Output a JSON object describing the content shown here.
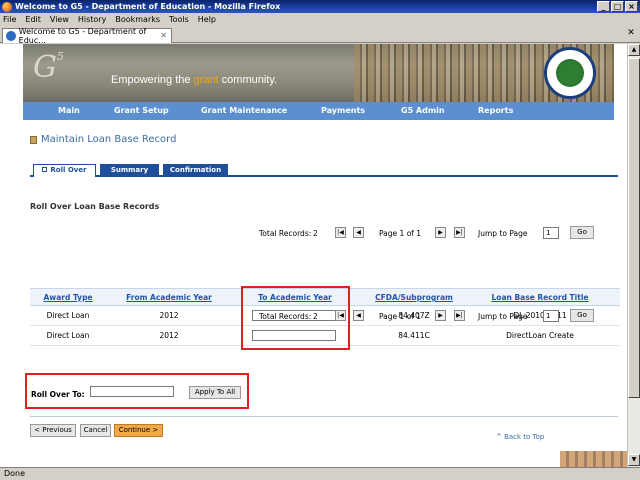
{
  "window": {
    "title": "Welcome to G5 - Department of Education - Mozilla Firefox"
  },
  "menu": [
    "File",
    "Edit",
    "View",
    "History",
    "Bookmarks",
    "Tools",
    "Help"
  ],
  "browser_tab": {
    "label": "Welcome to G5 - Department of Educ..."
  },
  "banner": {
    "logo_sup": "5",
    "tagline_pre": "Empowering the ",
    "tagline_grant": "grant",
    "tagline_post": " community."
  },
  "nav": [
    "Main",
    "Grant Setup",
    "Grant Maintenance",
    "Payments",
    "G5 Admin",
    "Reports"
  ],
  "page_title": "Maintain Loan Base Record",
  "tabs": [
    "Roll Over",
    "Summary",
    "Confirmation"
  ],
  "section_title": "Roll Over Loan Base Records",
  "pager": {
    "total_label": "Total Records:",
    "total": "2",
    "page_info": "Page 1 of 1",
    "jump_label": "Jump to Page",
    "jump_value": "1",
    "go": "Go"
  },
  "table": {
    "columns": [
      "Award Type",
      "From Academic Year",
      "To Academic Year",
      "CFDA/Subprogram",
      "Loan Base Record Title"
    ],
    "rows": [
      {
        "award_type": "Direct Loan",
        "from_year": "2012",
        "to_year": "",
        "cfda": "84.407Z",
        "title": "DL 2010-2011"
      },
      {
        "award_type": "Direct Loan",
        "from_year": "2012",
        "to_year": "",
        "cfda": "84.411C",
        "title": "DirectLoan Create"
      }
    ]
  },
  "rollover": {
    "label": "Roll Over To:",
    "value": "",
    "apply": "Apply To All"
  },
  "buttons": {
    "previous": "< Previous",
    "cancel": "Cancel",
    "continue": "Continue >"
  },
  "back_to_top": "^ Back to Top",
  "status": "Done"
}
